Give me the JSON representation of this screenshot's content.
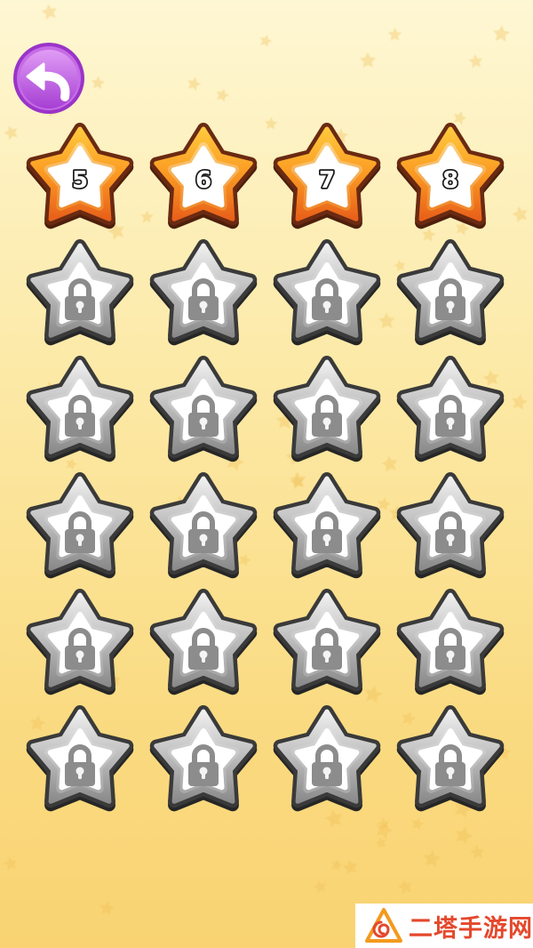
{
  "back_button": {
    "icon": "back-arrow-icon"
  },
  "levels": [
    {
      "label": "5",
      "locked": false
    },
    {
      "label": "6",
      "locked": false
    },
    {
      "label": "7",
      "locked": false
    },
    {
      "label": "8",
      "locked": false
    },
    {
      "locked": true,
      "icon": "lock-icon"
    },
    {
      "locked": true,
      "icon": "lock-icon"
    },
    {
      "locked": true,
      "icon": "lock-icon"
    },
    {
      "locked": true,
      "icon": "lock-icon"
    },
    {
      "locked": true,
      "icon": "lock-icon"
    },
    {
      "locked": true,
      "icon": "lock-icon"
    },
    {
      "locked": true,
      "icon": "lock-icon"
    },
    {
      "locked": true,
      "icon": "lock-icon"
    },
    {
      "locked": true,
      "icon": "lock-icon"
    },
    {
      "locked": true,
      "icon": "lock-icon"
    },
    {
      "locked": true,
      "icon": "lock-icon"
    },
    {
      "locked": true,
      "icon": "lock-icon"
    },
    {
      "locked": true,
      "icon": "lock-icon"
    },
    {
      "locked": true,
      "icon": "lock-icon"
    },
    {
      "locked": true,
      "icon": "lock-icon"
    },
    {
      "locked": true,
      "icon": "lock-icon"
    },
    {
      "locked": true,
      "icon": "lock-icon"
    },
    {
      "locked": true,
      "icon": "lock-icon"
    },
    {
      "locked": true,
      "icon": "lock-icon"
    },
    {
      "locked": true,
      "icon": "lock-icon"
    }
  ],
  "watermark": {
    "text": "二塔手游网",
    "logo_icon": "watermark-logo-icon"
  },
  "colors": {
    "back_button": "#9a34c8",
    "unlocked_star": "#f99a22",
    "locked_star": "#a6a6a6",
    "background": "#fce9a6",
    "watermark_text": "#e4482c"
  }
}
